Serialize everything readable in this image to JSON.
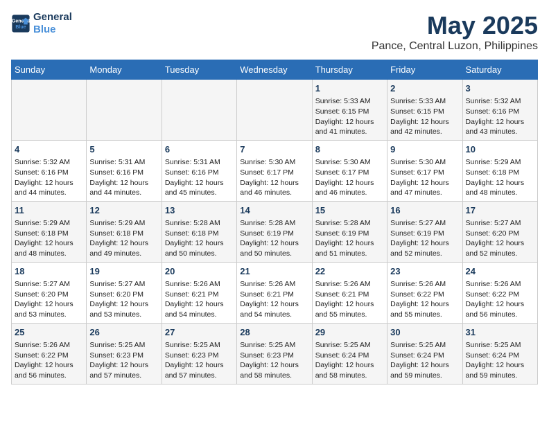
{
  "logo": {
    "line1": "General",
    "line2": "Blue"
  },
  "title": "May 2025",
  "location": "Pance, Central Luzon, Philippines",
  "days_of_week": [
    "Sunday",
    "Monday",
    "Tuesday",
    "Wednesday",
    "Thursday",
    "Friday",
    "Saturday"
  ],
  "weeks": [
    [
      {
        "day": "",
        "info": ""
      },
      {
        "day": "",
        "info": ""
      },
      {
        "day": "",
        "info": ""
      },
      {
        "day": "",
        "info": ""
      },
      {
        "day": "1",
        "info": "Sunrise: 5:33 AM\nSunset: 6:15 PM\nDaylight: 12 hours\nand 41 minutes."
      },
      {
        "day": "2",
        "info": "Sunrise: 5:33 AM\nSunset: 6:15 PM\nDaylight: 12 hours\nand 42 minutes."
      },
      {
        "day": "3",
        "info": "Sunrise: 5:32 AM\nSunset: 6:16 PM\nDaylight: 12 hours\nand 43 minutes."
      }
    ],
    [
      {
        "day": "4",
        "info": "Sunrise: 5:32 AM\nSunset: 6:16 PM\nDaylight: 12 hours\nand 44 minutes."
      },
      {
        "day": "5",
        "info": "Sunrise: 5:31 AM\nSunset: 6:16 PM\nDaylight: 12 hours\nand 44 minutes."
      },
      {
        "day": "6",
        "info": "Sunrise: 5:31 AM\nSunset: 6:16 PM\nDaylight: 12 hours\nand 45 minutes."
      },
      {
        "day": "7",
        "info": "Sunrise: 5:30 AM\nSunset: 6:17 PM\nDaylight: 12 hours\nand 46 minutes."
      },
      {
        "day": "8",
        "info": "Sunrise: 5:30 AM\nSunset: 6:17 PM\nDaylight: 12 hours\nand 46 minutes."
      },
      {
        "day": "9",
        "info": "Sunrise: 5:30 AM\nSunset: 6:17 PM\nDaylight: 12 hours\nand 47 minutes."
      },
      {
        "day": "10",
        "info": "Sunrise: 5:29 AM\nSunset: 6:18 PM\nDaylight: 12 hours\nand 48 minutes."
      }
    ],
    [
      {
        "day": "11",
        "info": "Sunrise: 5:29 AM\nSunset: 6:18 PM\nDaylight: 12 hours\nand 48 minutes."
      },
      {
        "day": "12",
        "info": "Sunrise: 5:29 AM\nSunset: 6:18 PM\nDaylight: 12 hours\nand 49 minutes."
      },
      {
        "day": "13",
        "info": "Sunrise: 5:28 AM\nSunset: 6:18 PM\nDaylight: 12 hours\nand 50 minutes."
      },
      {
        "day": "14",
        "info": "Sunrise: 5:28 AM\nSunset: 6:19 PM\nDaylight: 12 hours\nand 50 minutes."
      },
      {
        "day": "15",
        "info": "Sunrise: 5:28 AM\nSunset: 6:19 PM\nDaylight: 12 hours\nand 51 minutes."
      },
      {
        "day": "16",
        "info": "Sunrise: 5:27 AM\nSunset: 6:19 PM\nDaylight: 12 hours\nand 52 minutes."
      },
      {
        "day": "17",
        "info": "Sunrise: 5:27 AM\nSunset: 6:20 PM\nDaylight: 12 hours\nand 52 minutes."
      }
    ],
    [
      {
        "day": "18",
        "info": "Sunrise: 5:27 AM\nSunset: 6:20 PM\nDaylight: 12 hours\nand 53 minutes."
      },
      {
        "day": "19",
        "info": "Sunrise: 5:27 AM\nSunset: 6:20 PM\nDaylight: 12 hours\nand 53 minutes."
      },
      {
        "day": "20",
        "info": "Sunrise: 5:26 AM\nSunset: 6:21 PM\nDaylight: 12 hours\nand 54 minutes."
      },
      {
        "day": "21",
        "info": "Sunrise: 5:26 AM\nSunset: 6:21 PM\nDaylight: 12 hours\nand 54 minutes."
      },
      {
        "day": "22",
        "info": "Sunrise: 5:26 AM\nSunset: 6:21 PM\nDaylight: 12 hours\nand 55 minutes."
      },
      {
        "day": "23",
        "info": "Sunrise: 5:26 AM\nSunset: 6:22 PM\nDaylight: 12 hours\nand 55 minutes."
      },
      {
        "day": "24",
        "info": "Sunrise: 5:26 AM\nSunset: 6:22 PM\nDaylight: 12 hours\nand 56 minutes."
      }
    ],
    [
      {
        "day": "25",
        "info": "Sunrise: 5:26 AM\nSunset: 6:22 PM\nDaylight: 12 hours\nand 56 minutes."
      },
      {
        "day": "26",
        "info": "Sunrise: 5:25 AM\nSunset: 6:23 PM\nDaylight: 12 hours\nand 57 minutes."
      },
      {
        "day": "27",
        "info": "Sunrise: 5:25 AM\nSunset: 6:23 PM\nDaylight: 12 hours\nand 57 minutes."
      },
      {
        "day": "28",
        "info": "Sunrise: 5:25 AM\nSunset: 6:23 PM\nDaylight: 12 hours\nand 58 minutes."
      },
      {
        "day": "29",
        "info": "Sunrise: 5:25 AM\nSunset: 6:24 PM\nDaylight: 12 hours\nand 58 minutes."
      },
      {
        "day": "30",
        "info": "Sunrise: 5:25 AM\nSunset: 6:24 PM\nDaylight: 12 hours\nand 59 minutes."
      },
      {
        "day": "31",
        "info": "Sunrise: 5:25 AM\nSunset: 6:24 PM\nDaylight: 12 hours\nand 59 minutes."
      }
    ]
  ]
}
